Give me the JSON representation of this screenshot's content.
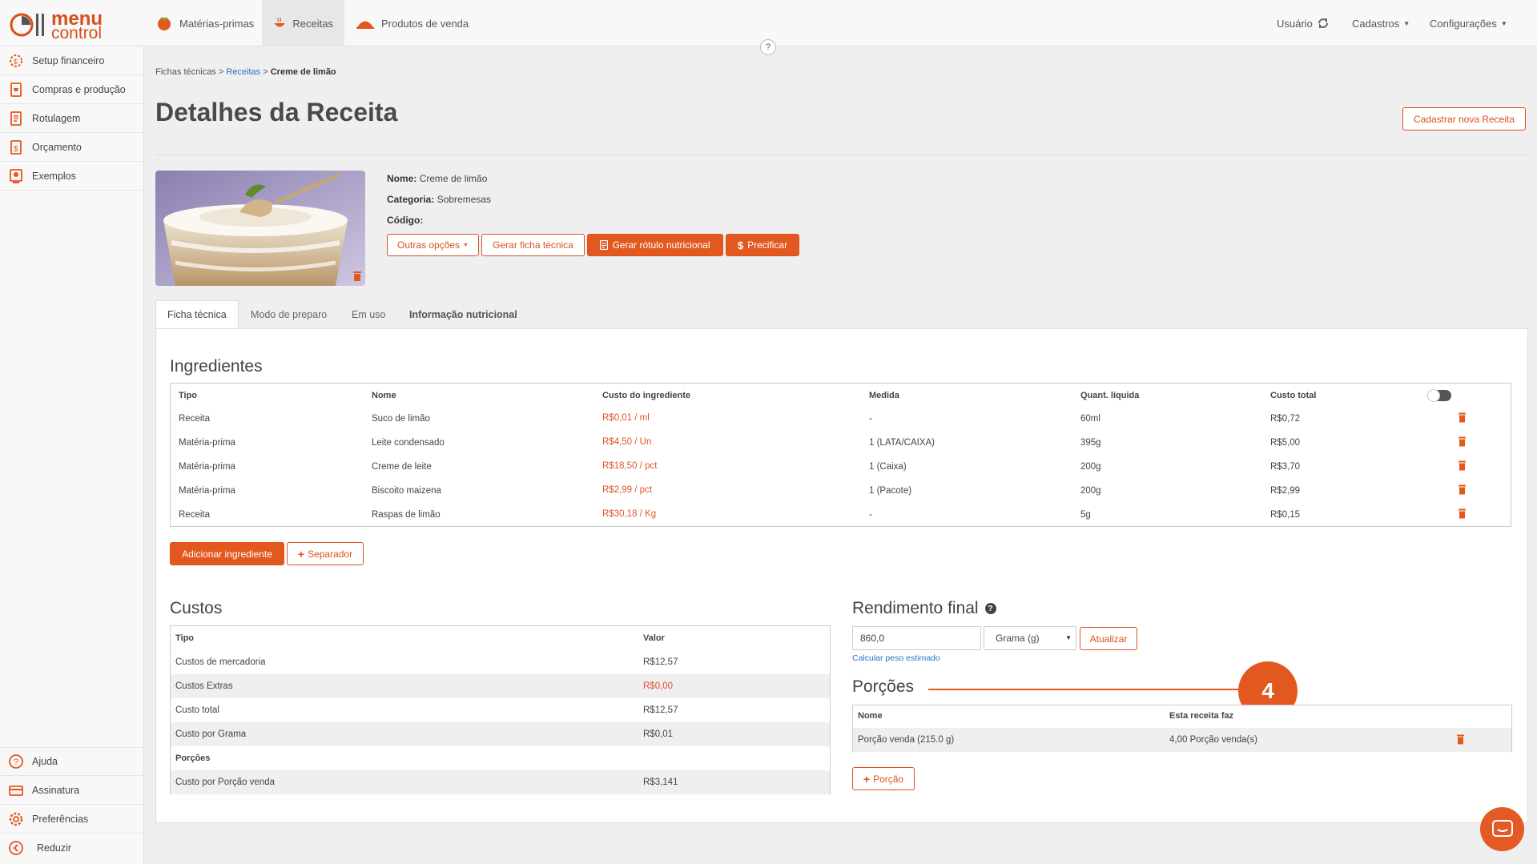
{
  "topnav": {
    "logo_line1": "menu",
    "logo_line2": "control",
    "items": [
      {
        "label": "Matérias-primas"
      },
      {
        "label": "Receitas"
      },
      {
        "label": "Produtos de venda"
      }
    ],
    "usuario": "Usuário",
    "cadastros": "Cadastros",
    "configuracoes": "Configurações",
    "help": "?"
  },
  "sidebar": {
    "items": [
      {
        "label": "Setup financeiro"
      },
      {
        "label": "Compras e produção"
      },
      {
        "label": "Rotulagem"
      },
      {
        "label": "Orçamento"
      },
      {
        "label": "Exemplos"
      }
    ],
    "bottom": [
      {
        "label": "Ajuda"
      },
      {
        "label": "Assinatura"
      },
      {
        "label": "Preferências"
      },
      {
        "label": "Reduzir"
      }
    ]
  },
  "breadcrumb": {
    "root": "Fichas técnicas",
    "sep": ">",
    "link": "Receitas",
    "current": "Creme de limão"
  },
  "page": {
    "title": "Detalhes da Receita",
    "new_button": "Cadastrar nova Receita"
  },
  "recipe": {
    "name_label": "Nome:",
    "name_value": "Creme de limão",
    "category_label": "Categoria:",
    "category_value": "Sobremesas",
    "code_label": "Código:",
    "code_value": ""
  },
  "actions": {
    "outras": "Outras opções",
    "gerar_ficha": "Gerar ficha técnica",
    "gerar_rotulo": "Gerar rótulo nutricional",
    "precificar": "Precificar"
  },
  "tabs": [
    {
      "label": "Ficha técnica"
    },
    {
      "label": "Modo de preparo"
    },
    {
      "label": "Em uso"
    },
    {
      "label": "Informação nutricional"
    }
  ],
  "ingredients": {
    "title": "Ingredientes",
    "headers": [
      "Tipo",
      "Nome",
      "Custo do ingrediente",
      "Medida",
      "Quant. líquida",
      "Custo total"
    ],
    "rows": [
      {
        "tipo": "Receita",
        "nome": "Suco de limão",
        "custo": "R$0,01 / ml",
        "medida": "-",
        "quant": "60ml",
        "total": "R$0,72"
      },
      {
        "tipo": "Matéria-prima",
        "nome": "Leite condensado",
        "custo": "R$4,50 / Un",
        "medida": "1 (LATA/CAIXA)",
        "quant": "395g",
        "total": "R$5,00"
      },
      {
        "tipo": "Matéria-prima",
        "nome": "Creme de leite",
        "custo": "R$18,50 / pct",
        "medida": "1 (Caixa)",
        "quant": "200g",
        "total": "R$3,70"
      },
      {
        "tipo": "Matéria-prima",
        "nome": "Biscoito maizena",
        "custo": "R$2,99 / pct",
        "medida": "1 (Pacote)",
        "quant": "200g",
        "total": "R$2,99"
      },
      {
        "tipo": "Receita",
        "nome": "Raspas de limão",
        "custo": "R$30,18 / Kg",
        "medida": "-",
        "quant": "5g",
        "total": "R$0,15"
      }
    ],
    "add_button": "Adicionar ingrediente",
    "separator_button": "Separador"
  },
  "costs": {
    "title": "Custos",
    "headers": [
      "Tipo",
      "Valor"
    ],
    "rows": [
      {
        "tipo": "Custos de mercadoria",
        "valor": "R$12,57"
      },
      {
        "tipo": "Custos Extras",
        "valor": "R$0,00"
      },
      {
        "tipo": "Custo total",
        "valor": "R$12,57"
      },
      {
        "tipo": "Custo por Grama",
        "valor": "R$0,01"
      }
    ],
    "porcoes_label": "Porções",
    "porcao_row": {
      "tipo": "Custo por Porção venda",
      "valor": "R$3,141"
    }
  },
  "rendimento": {
    "title": "Rendimento final",
    "value": "860,0",
    "unit": "Grama (g)",
    "update_button": "Atualizar",
    "calc_link": "Calcular peso estimado"
  },
  "porcoes": {
    "title": "Porções",
    "headers": [
      "Nome",
      "Esta receita faz"
    ],
    "rows": [
      {
        "nome": "Porção venda (215.0 g)",
        "faz": "4,00 Porção venda(s)"
      }
    ],
    "add_button": "Porção"
  },
  "annotation": {
    "number": "4"
  },
  "colors": {
    "accent": "#e2581f",
    "link": "#2a72c4",
    "price": "#e0542a"
  }
}
